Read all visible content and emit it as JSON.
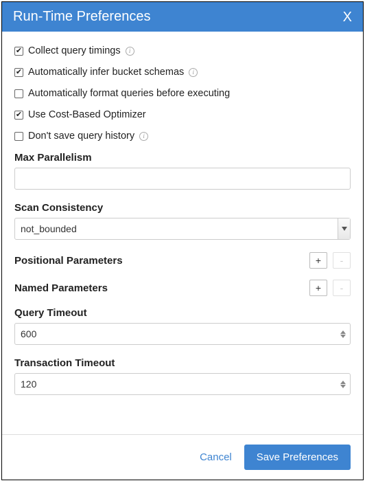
{
  "header": {
    "title": "Run-Time Preferences",
    "close_label": "X"
  },
  "checkboxes": {
    "collect_timings": {
      "label": "Collect query timings",
      "checked": true,
      "info": true
    },
    "infer_schemas": {
      "label": "Automatically infer bucket schemas",
      "checked": true,
      "info": true
    },
    "auto_format": {
      "label": "Automatically format queries before executing",
      "checked": false,
      "info": false
    },
    "cbo": {
      "label": "Use Cost-Based Optimizer",
      "checked": true,
      "info": false
    },
    "no_history": {
      "label": "Don't save query history",
      "checked": false,
      "info": true
    }
  },
  "fields": {
    "max_parallelism": {
      "label": "Max Parallelism",
      "value": ""
    },
    "scan_consistency": {
      "label": "Scan Consistency",
      "value": "not_bounded"
    },
    "positional_params": {
      "label": "Positional Parameters",
      "plus": "+",
      "minus": "-"
    },
    "named_params": {
      "label": "Named Parameters",
      "plus": "+",
      "minus": "-"
    },
    "query_timeout": {
      "label": "Query Timeout",
      "value": "600"
    },
    "transaction_timeout": {
      "label": "Transaction Timeout",
      "value": "120"
    }
  },
  "footer": {
    "cancel": "Cancel",
    "save": "Save Preferences"
  }
}
